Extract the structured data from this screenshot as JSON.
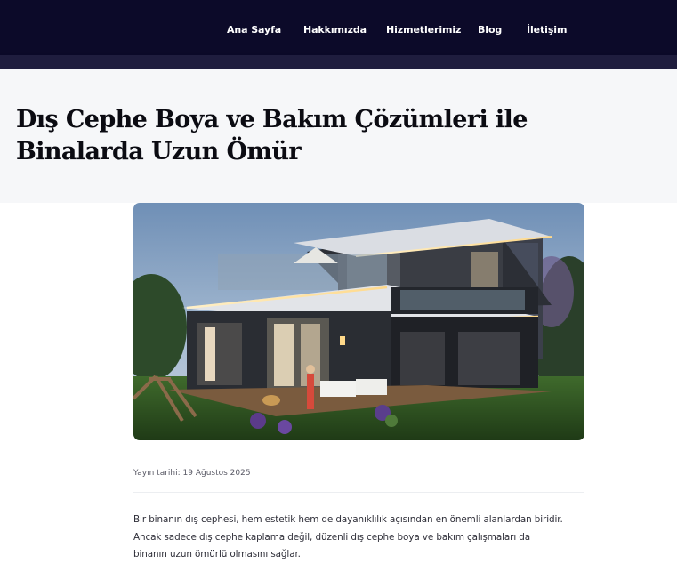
{
  "nav": {
    "items": [
      {
        "label": "Ana Sayfa"
      },
      {
        "label": "Hakkımızda"
      },
      {
        "label": "Hizmetlerimiz"
      },
      {
        "label": "Blog"
      },
      {
        "label": "İletişim"
      }
    ]
  },
  "article": {
    "title": "Dış Cephe Boya ve Bakım Çözümleri ile Binalarda Uzun Ömür",
    "image_icon": "modern-villa-exterior-image",
    "meta": "Yayın tarihi: 19 Ağustos 2025",
    "body_lines": [
      "Bir binanın dış cephesi, hem estetik hem de dayanıklılık açısından en önemli alanlardan biridir.",
      "Ancak sadece dış cephe kaplama değil, düzenli dış cephe boya ve bakım çalışmaları da",
      "binanın uzun ömürlü olmasını sağlar."
    ]
  },
  "colors": {
    "header_bg": "#0c0a29",
    "header_strip": "#1f1d3e",
    "hero_bg": "#f6f7f9",
    "title_color": "#0b0b12"
  }
}
